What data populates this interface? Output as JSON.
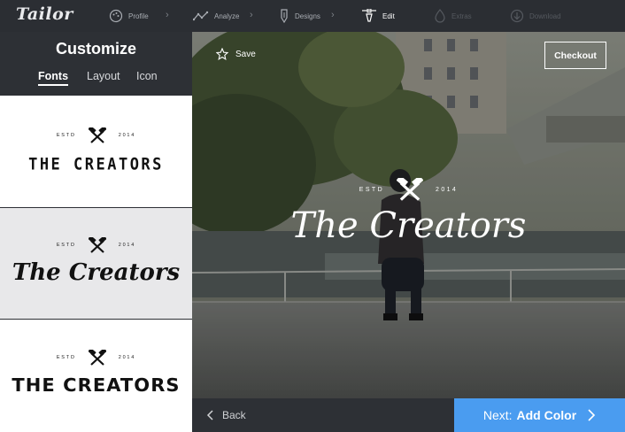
{
  "app": {
    "name": "Tailor"
  },
  "steps": [
    {
      "label": "Profile",
      "icon": "palette-icon"
    },
    {
      "label": "Analyze",
      "icon": "analyze-icon"
    },
    {
      "label": "Designs",
      "icon": "pen-nib-icon"
    },
    {
      "label": "Edit",
      "icon": "bezier-pen-icon"
    },
    {
      "label": "Extras",
      "icon": "drop-icon"
    },
    {
      "label": "Download",
      "icon": "download-icon"
    }
  ],
  "active_step": "Edit",
  "sidebar": {
    "title": "Customize",
    "tabs": [
      {
        "label": "Fonts",
        "active": true
      },
      {
        "label": "Layout",
        "active": false
      },
      {
        "label": "Icon",
        "active": false
      }
    ],
    "options": [
      {
        "estd": "ESTD",
        "year": "2014",
        "text": "THE CREATORS",
        "icon": "crossed-hammers-icon"
      },
      {
        "estd": "ESTD",
        "year": "2014",
        "text": "The Creators",
        "icon": "crossed-hammers-icon"
      },
      {
        "estd": "ESTD",
        "year": "2014",
        "text": "THE CREATORS",
        "icon": "crossed-hammers-icon"
      }
    ]
  },
  "preview": {
    "save_label": "Save",
    "checkout_label": "Checkout",
    "logo": {
      "estd": "ESTD",
      "year": "2014",
      "text": "The Creators",
      "icon": "crossed-hammers-icon"
    }
  },
  "footer": {
    "back_label": "Back",
    "next_prefix": "Next:",
    "next_label": "Add Color"
  },
  "colors": {
    "topbar": "#2b2e33",
    "panel": "#2d3035",
    "accent": "#4a9cf0",
    "card_selected": "#e8e8ea",
    "card": "#ffffff"
  }
}
